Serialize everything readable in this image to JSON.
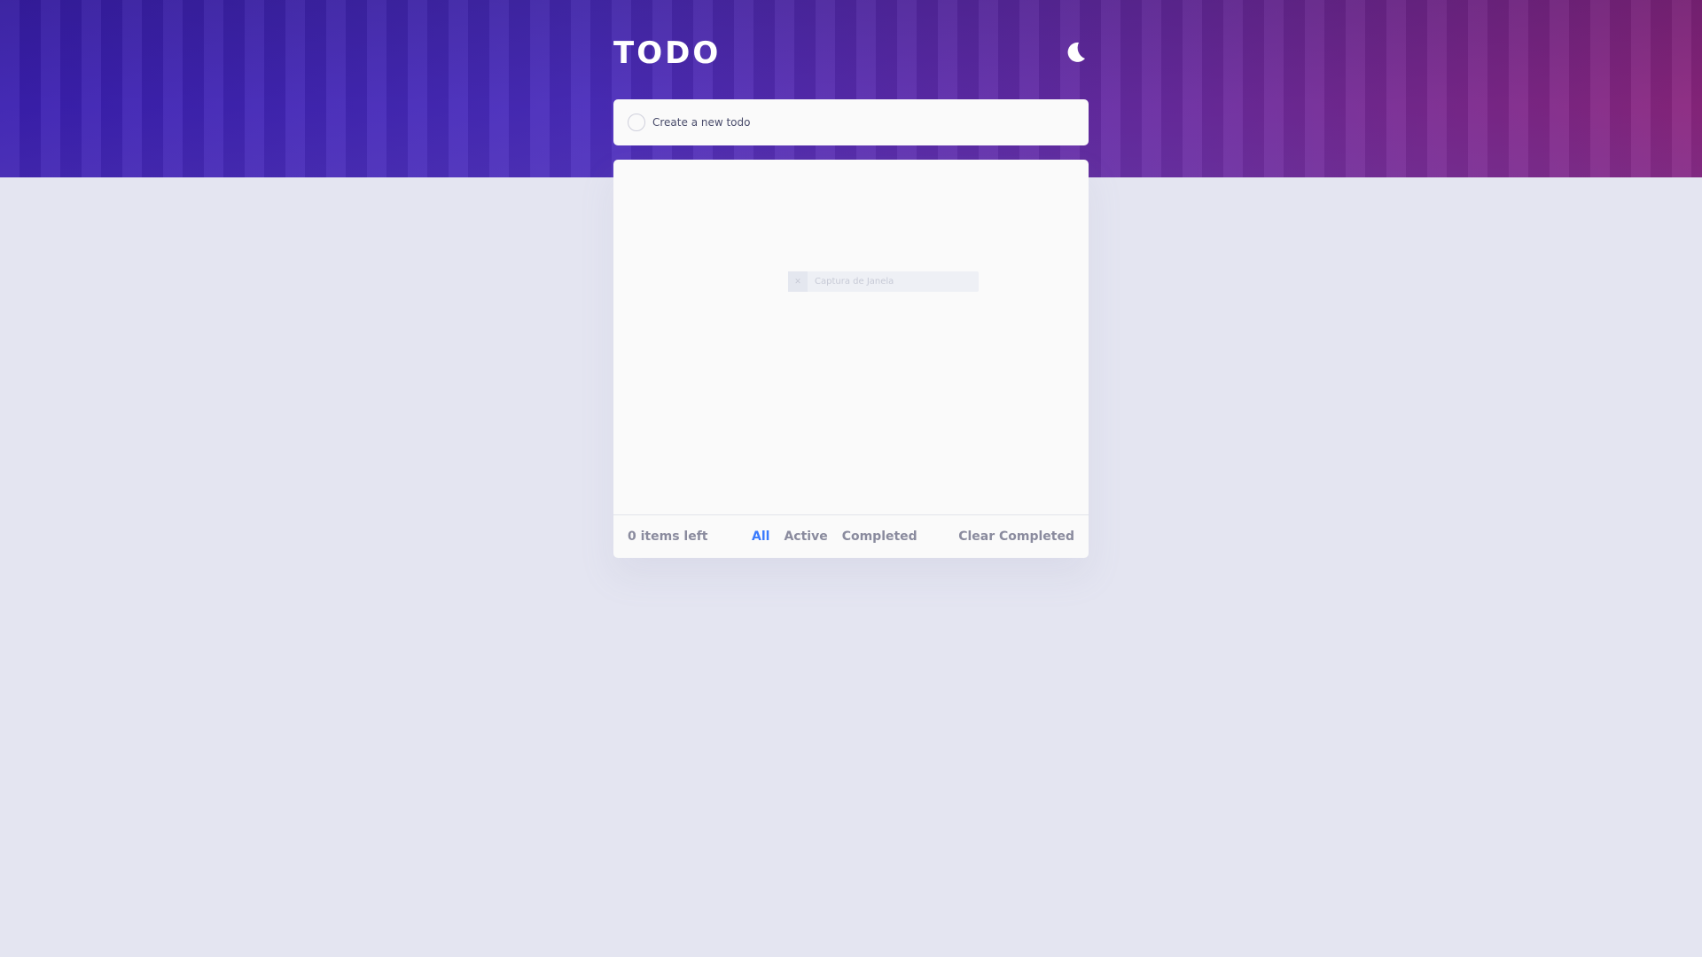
{
  "header": {
    "title": "TODO",
    "theme_icon": "moon-icon"
  },
  "new_todo": {
    "placeholder": "Create a new todo",
    "value": ""
  },
  "ghost_item": {
    "text": "Captura de Janela"
  },
  "footer": {
    "items_left": "0 items left",
    "filters": [
      {
        "label": "All",
        "selected": true
      },
      {
        "label": "Active",
        "selected": false
      },
      {
        "label": "Completed",
        "selected": false
      }
    ],
    "clear_label": "Clear Completed"
  },
  "colors": {
    "page_bg": "#e4e5f1",
    "panel_bg": "#fafafa",
    "accent": "#3a7bfd",
    "muted_text": "#8a8b9e",
    "text": "#494c6b"
  }
}
